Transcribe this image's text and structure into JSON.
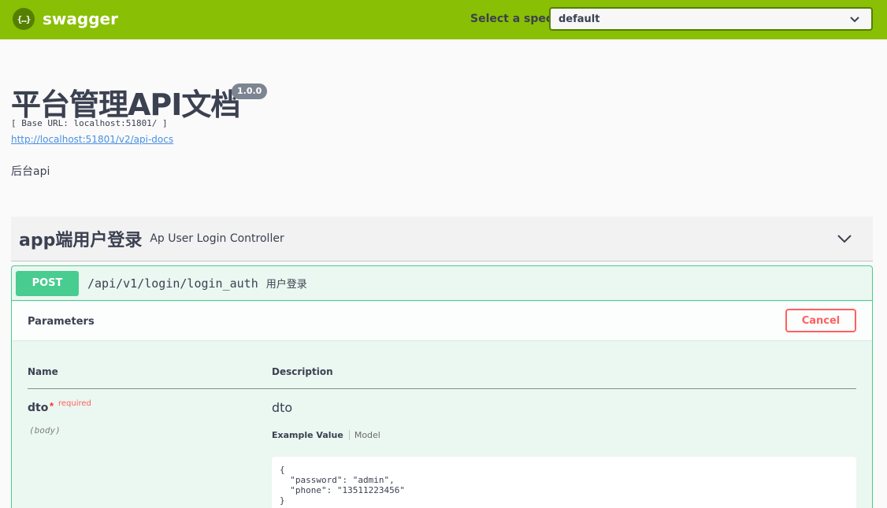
{
  "topbar": {
    "logo_glyph": "{…}",
    "brand": "swagger",
    "spec_label": "Select a spec",
    "spec_value": "default",
    "colors": {
      "background": "#89bf04",
      "select_border": "#547f00"
    }
  },
  "info": {
    "title": "平台管理API文档",
    "version": "1.0.0",
    "base_url": "[ Base URL: localhost:51801/ ]",
    "docs_link": "http://localhost:51801/v2/api-docs",
    "description": "后台api"
  },
  "tag": {
    "name": "app端用户登录",
    "description": "Ap User Login Controller",
    "chevron_icon": "chevron-down-icon"
  },
  "operation": {
    "method": "POST",
    "path": "/api/v1/login/login_auth",
    "summary": "用户登录",
    "colors": {
      "method": "#49cc90",
      "background": "#ebf7f1"
    },
    "parameters_title": "Parameters",
    "cancel_label": "Cancel",
    "columns": {
      "name": "Name",
      "description": "Description"
    },
    "params": [
      {
        "name": "dto",
        "required_star": "*",
        "required_label": "required",
        "in": "(body)",
        "description": "dto",
        "tabs": {
          "example": "Example Value",
          "model": "Model"
        },
        "example_value": "{\n  \"password\": \"admin\",\n  \"phone\": \"13511223456\"\n}"
      }
    ]
  }
}
